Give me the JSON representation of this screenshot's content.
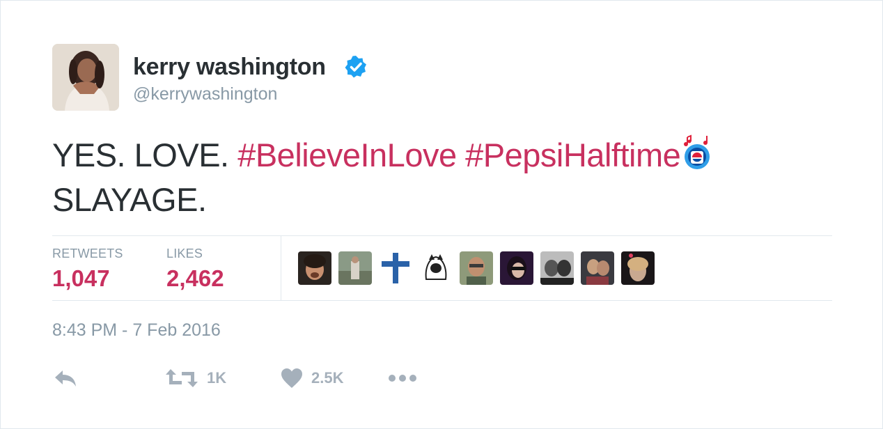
{
  "user": {
    "display_name": "kerry washington",
    "handle": "@kerrywashington"
  },
  "tweet": {
    "text_plain_1": "YES. LOVE.",
    "hashtag_1": "#BelieveInLove",
    "hashtag_2": "#PepsiHalftime",
    "text_plain_2": "SLAYAGE.",
    "emoji": "pepsi-halftime-emoji"
  },
  "stats": {
    "retweets_label": "RETWEETS",
    "retweets_value": "1,047",
    "likes_label": "LIKES",
    "likes_value": "2,462"
  },
  "likers": [
    {
      "name": "liker-avatar-1"
    },
    {
      "name": "liker-avatar-2"
    },
    {
      "name": "liker-avatar-3"
    },
    {
      "name": "liker-avatar-4"
    },
    {
      "name": "liker-avatar-5"
    },
    {
      "name": "liker-avatar-6"
    },
    {
      "name": "liker-avatar-7"
    },
    {
      "name": "liker-avatar-8"
    },
    {
      "name": "liker-avatar-9"
    }
  ],
  "timestamp": "8:43 PM - 7 Feb 2016",
  "actions": {
    "reply_icon": "reply-icon",
    "retweet_icon": "retweet-icon",
    "retweet_count": "1K",
    "like_icon": "heart-icon",
    "like_count": "2.5K",
    "more_icon": "more-icon"
  },
  "colors": {
    "hashtag": "#c8305f",
    "verified": "#1da1f2",
    "muted": "#8899a6",
    "text": "#292f33",
    "divider": "#e1e8ed"
  }
}
